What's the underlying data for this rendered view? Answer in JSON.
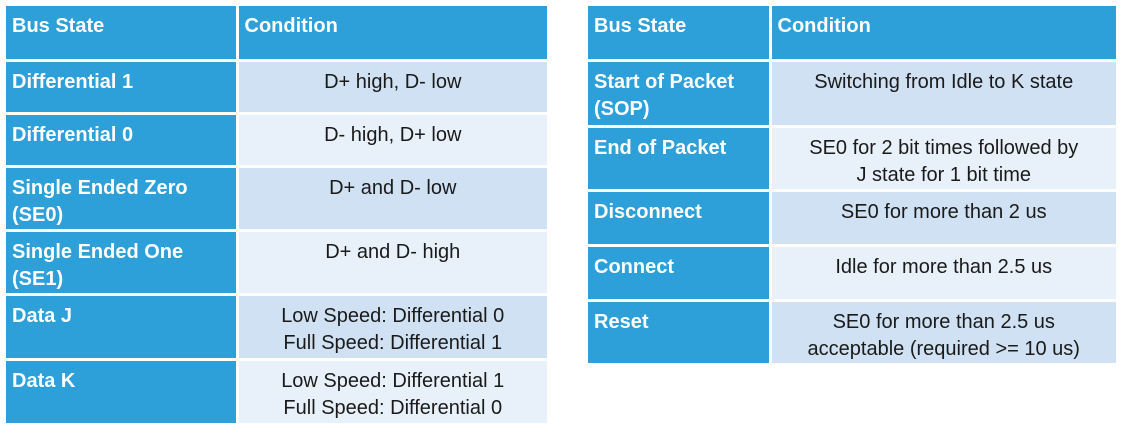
{
  "left_table": {
    "headers": [
      "Bus State",
      "Condition"
    ],
    "rows": [
      {
        "state": "Differential 1",
        "condition": "D+ high, D- low"
      },
      {
        "state": "Differential 0",
        "condition": "D- high, D+ low"
      },
      {
        "state": "Single Ended Zero (SE0)",
        "condition": "D+ and D- low"
      },
      {
        "state": "Single Ended One (SE1)",
        "condition": "D+ and D- high"
      },
      {
        "state": "Data J",
        "condition": "Low Speed: Differential 0\nFull Speed: Differential 1"
      },
      {
        "state": "Data K",
        "condition": "Low Speed: Differential 1\nFull Speed: Differential 0"
      }
    ]
  },
  "right_table": {
    "headers": [
      "Bus State",
      "Condition"
    ],
    "rows": [
      {
        "state": "Start of Packet (SOP)",
        "condition": "Switching from Idle to K state"
      },
      {
        "state": "End of Packet",
        "condition": "SE0 for 2 bit times followed by\nJ state for 1 bit time"
      },
      {
        "state": "Disconnect",
        "condition": "SE0 for more than 2 us"
      },
      {
        "state": "Connect",
        "condition": "Idle for more than 2.5 us"
      },
      {
        "state": "Reset",
        "condition": "SE0 for more than 2.5 us\nacceptable (required >= 10 us)"
      }
    ]
  },
  "colors": {
    "header_blue": "#2d9fd9",
    "row_shade_a": "#cfe1f2",
    "row_shade_b": "#e8f1fa"
  }
}
